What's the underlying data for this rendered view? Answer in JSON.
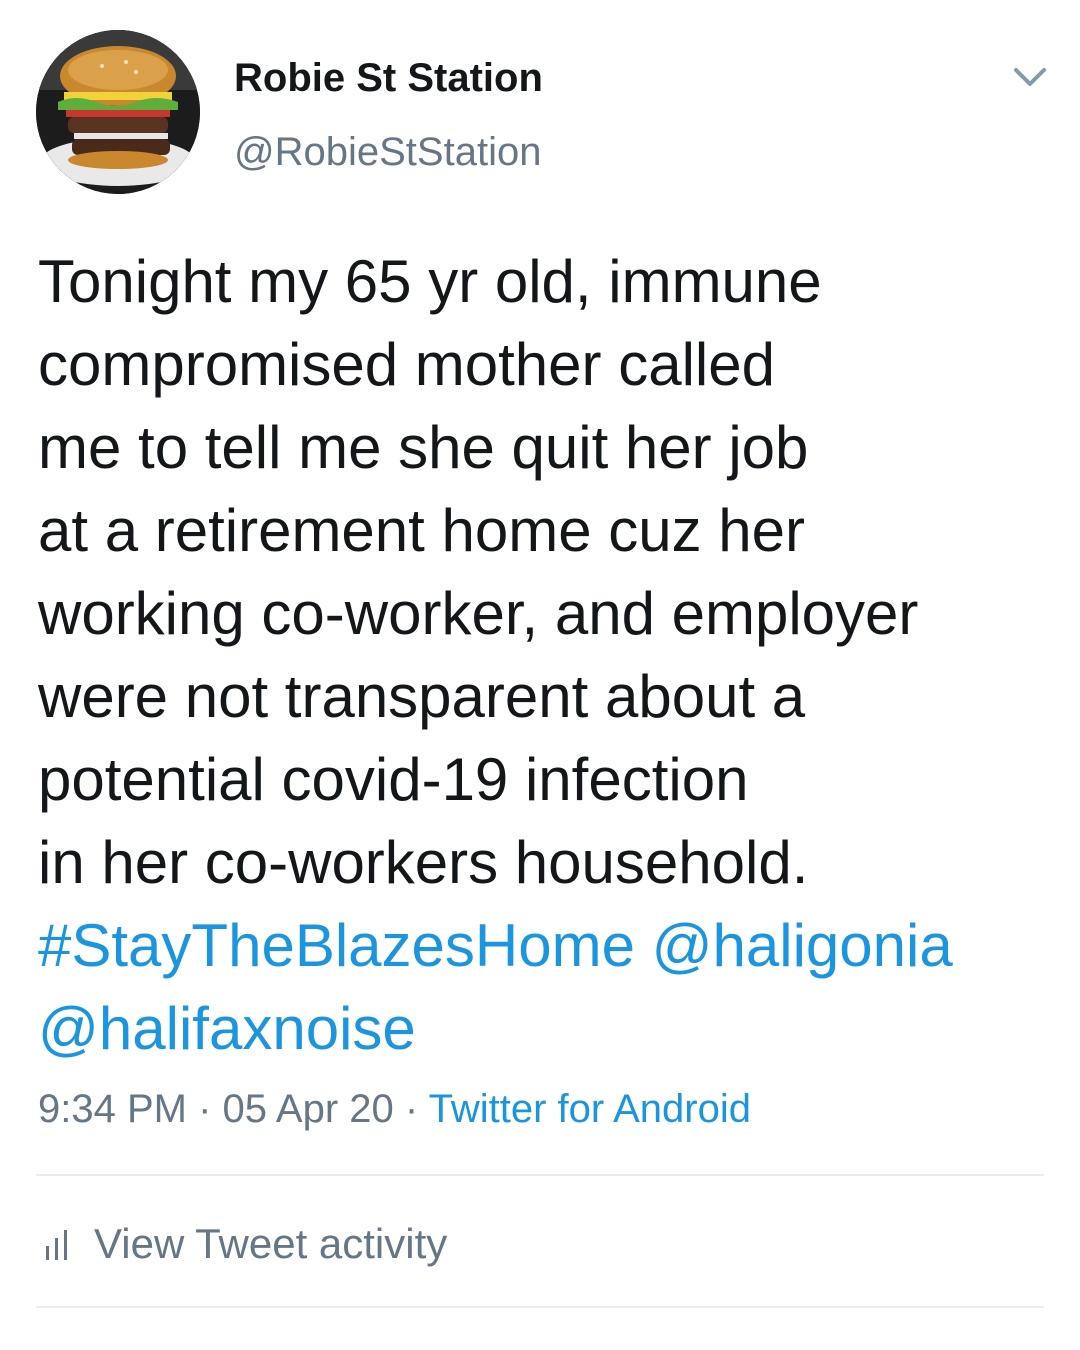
{
  "author": {
    "name": "Robie St Station",
    "handle": "@RobieStStation",
    "avatar_icon": "burger-photo-avatar"
  },
  "tweet": {
    "lines": [
      "Tonight my 65 yr old, immune",
      "compromised mother called",
      "me to tell me she quit her job",
      "at a retirement home cuz her",
      "working co-worker, and employer",
      "were not transparent about a",
      "potential covid-19 infection",
      "in her co-workers household."
    ],
    "hashtag": "#StayTheBlazesHome",
    "mention_1": "@haligonia",
    "mention_2": "@halifaxnoise"
  },
  "meta": {
    "time": "9:34 PM",
    "separator": " · ",
    "date": "05 Apr 20",
    "source": "Twitter for Android"
  },
  "activity": {
    "label": "View Tweet activity",
    "icon": "bar-chart-icon"
  },
  "colors": {
    "link": "#1b95e0",
    "secondary_text": "#657786",
    "primary_text": "#14171a",
    "divider": "#e6ecf0"
  }
}
